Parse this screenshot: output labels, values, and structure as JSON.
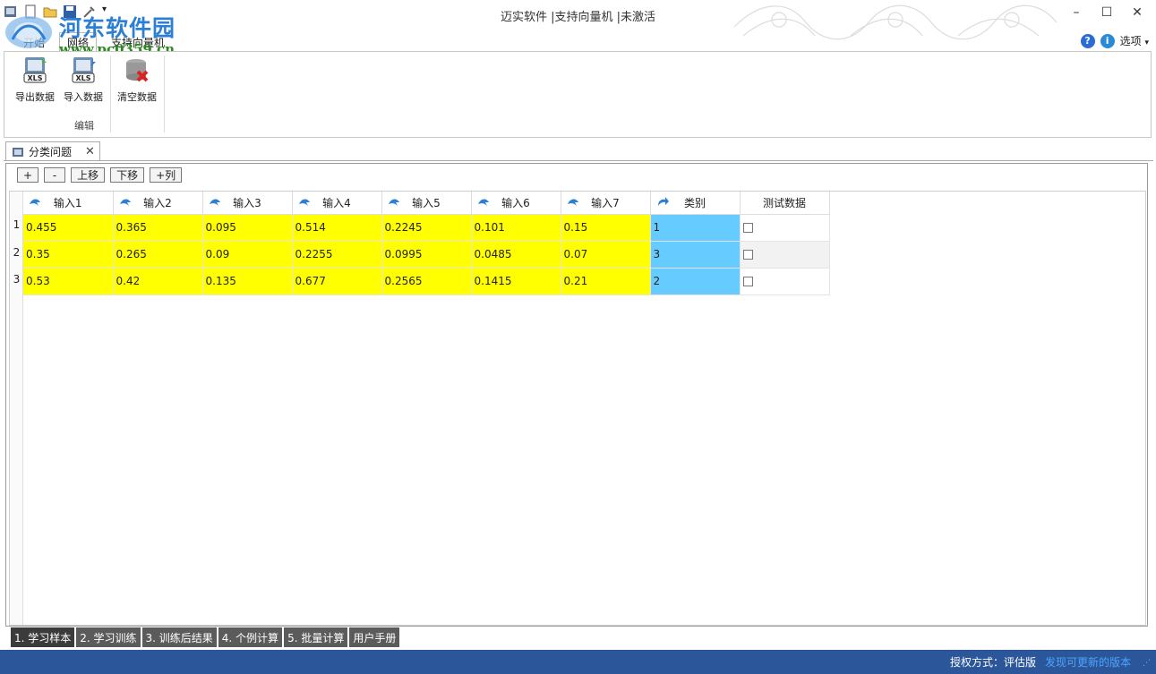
{
  "window": {
    "title": "迈实软件 |支持向量机 |未激活",
    "minimize": "–",
    "maximize": "☐",
    "close": "✕"
  },
  "watermark": {
    "name": "河东软件园",
    "url": "www.pc0359.cn"
  },
  "ribbon": {
    "tabs": [
      "开始",
      "网络",
      "支持向量机"
    ],
    "options_label": "选项",
    "buttons": {
      "export": "导出数据",
      "import": "导入数据",
      "clear": "清空数据"
    },
    "group_label": "编辑"
  },
  "document_tab": {
    "label": "分类问题",
    "close": "✕"
  },
  "toolbar": {
    "add": "+",
    "remove": "-",
    "move_up": "上移",
    "move_down": "下移",
    "add_column": "+列"
  },
  "grid": {
    "columns": [
      "输入1",
      "输入2",
      "输入3",
      "输入4",
      "输入5",
      "输入6",
      "输入7",
      "类别",
      "测试数据"
    ],
    "rows": [
      {
        "num": "1",
        "cells": [
          "0.455",
          "0.365",
          "0.095",
          "0.514",
          "0.2245",
          "0.101",
          "0.15"
        ],
        "category": "1"
      },
      {
        "num": "2",
        "cells": [
          "0.35",
          "0.265",
          "0.09",
          "0.2255",
          "0.0995",
          "0.0485",
          "0.07"
        ],
        "category": "3"
      },
      {
        "num": "3",
        "cells": [
          "0.53",
          "0.42",
          "0.135",
          "0.677",
          "0.2565",
          "0.1415",
          "0.21"
        ],
        "category": "2"
      }
    ]
  },
  "bottom_tabs": [
    "1. 学习样本",
    "2. 学习训练",
    "3. 训练后结果",
    "4. 个例计算",
    "5. 批量计算",
    "用户手册"
  ],
  "status": {
    "auth": "授权方式：评估版",
    "update": "发现可更新的版本"
  },
  "colors": {
    "input_cell": "#ffff00",
    "category_cell": "#66ccff",
    "status_bar": "#2b579a"
  }
}
